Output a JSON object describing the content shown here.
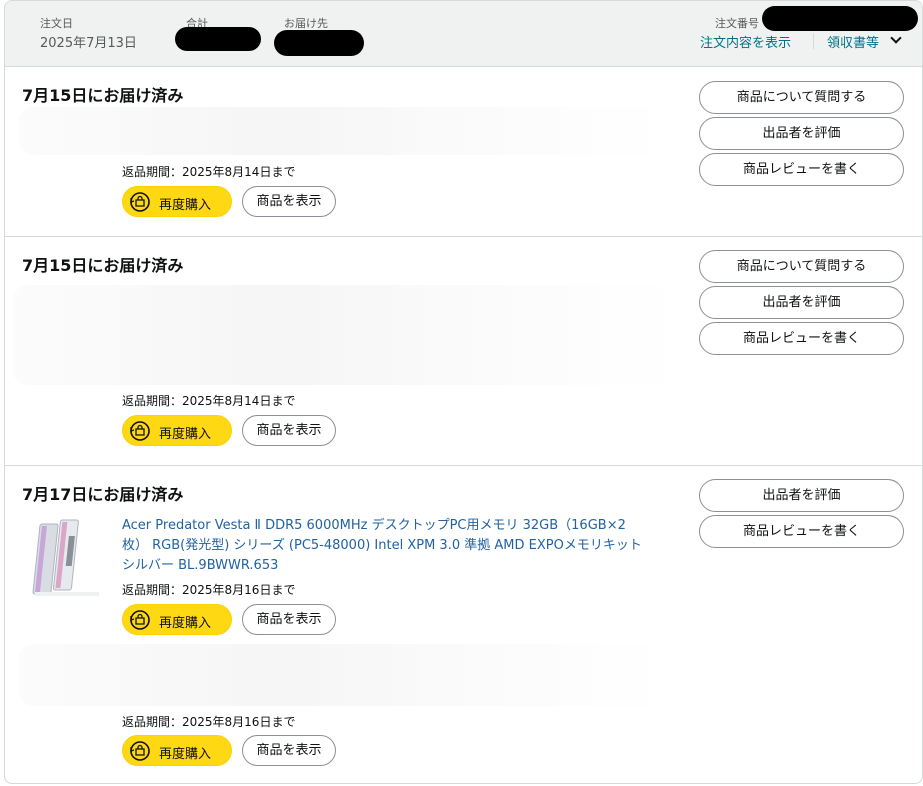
{
  "header": {
    "order_date_label": "注文日",
    "order_date": "2025年7月13日",
    "total_label": "合計",
    "ship_to_label": "お届け先",
    "order_number_label": "注文番号",
    "order_details_link": "注文内容を表示",
    "receipt_link": "領収書等"
  },
  "shipments": [
    {
      "title": "7月15日にお届け済み",
      "return_text": "返品期間：2025年8月14日まで",
      "buy_again": "再度購入",
      "view_item": "商品を表示",
      "actions": [
        "商品について質問する",
        "出品者を評価",
        "商品レビューを書く"
      ]
    },
    {
      "title": "7月15日にお届け済み",
      "return_text": "返品期間：2025年8月14日まで",
      "buy_again": "再度購入",
      "view_item": "商品を表示",
      "actions": [
        "商品について質問する",
        "出品者を評価",
        "商品レビューを書く"
      ]
    },
    {
      "title": "7月17日にお届け済み",
      "actions": [
        "出品者を評価",
        "商品レビューを書く"
      ],
      "items": [
        {
          "product_title": "Acer Predator Vesta Ⅱ DDR5 6000MHz デスクトップPC用メモリ 32GB（16GB×2枚） RGB(発光型) シリーズ (PC5-48000) Intel XPM 3.0 準拠 AMD EXPOメモリキット シルバー BL.9BWWR.653",
          "return_text": "返品期間：2025年8月16日まで",
          "buy_again": "再度購入",
          "view_item": "商品を表示"
        },
        {
          "return_text": "返品期間：2025年8月16日まで",
          "buy_again": "再度購入",
          "view_item": "商品を表示"
        }
      ]
    }
  ],
  "colors": {
    "header_bg": "#f0f2f2",
    "link": "#007185",
    "product_link": "#2162a1",
    "buy_button": "#ffd814",
    "border": "#d5d9d9"
  }
}
